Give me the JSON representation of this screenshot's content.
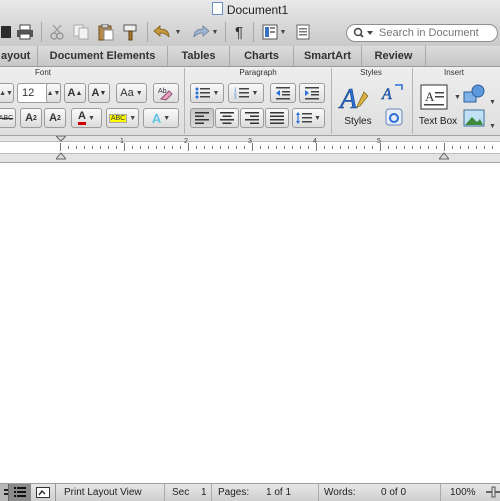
{
  "window": {
    "title": "Document1"
  },
  "search": {
    "placeholder": "Search in Document"
  },
  "ribbon_tabs": [
    "ayout",
    "Document Elements",
    "Tables",
    "Charts",
    "SmartArt",
    "Review"
  ],
  "ribbon": {
    "font_group": {
      "label": "Font",
      "size_value": "12"
    },
    "paragraph_group": {
      "label": "Paragraph"
    },
    "styles_group": {
      "label": "Styles",
      "styles_button": "Styles"
    },
    "insert_group": {
      "label": "Insert",
      "text_box_button": "Text Box"
    }
  },
  "ruler_numbers": [
    "1",
    "2",
    "3",
    "4",
    "5"
  ],
  "status": {
    "view": "Print Layout View",
    "sec_label": "Sec",
    "sec_value": "1",
    "pages_label": "Pages:",
    "pages_value": "1 of 1",
    "words_label": "Words:",
    "words_value": "0 of 0",
    "zoom": "100%"
  },
  "colors": {
    "font_color": "#d00000",
    "highlight": "#ffff00",
    "accent": "#2a6fd6"
  }
}
